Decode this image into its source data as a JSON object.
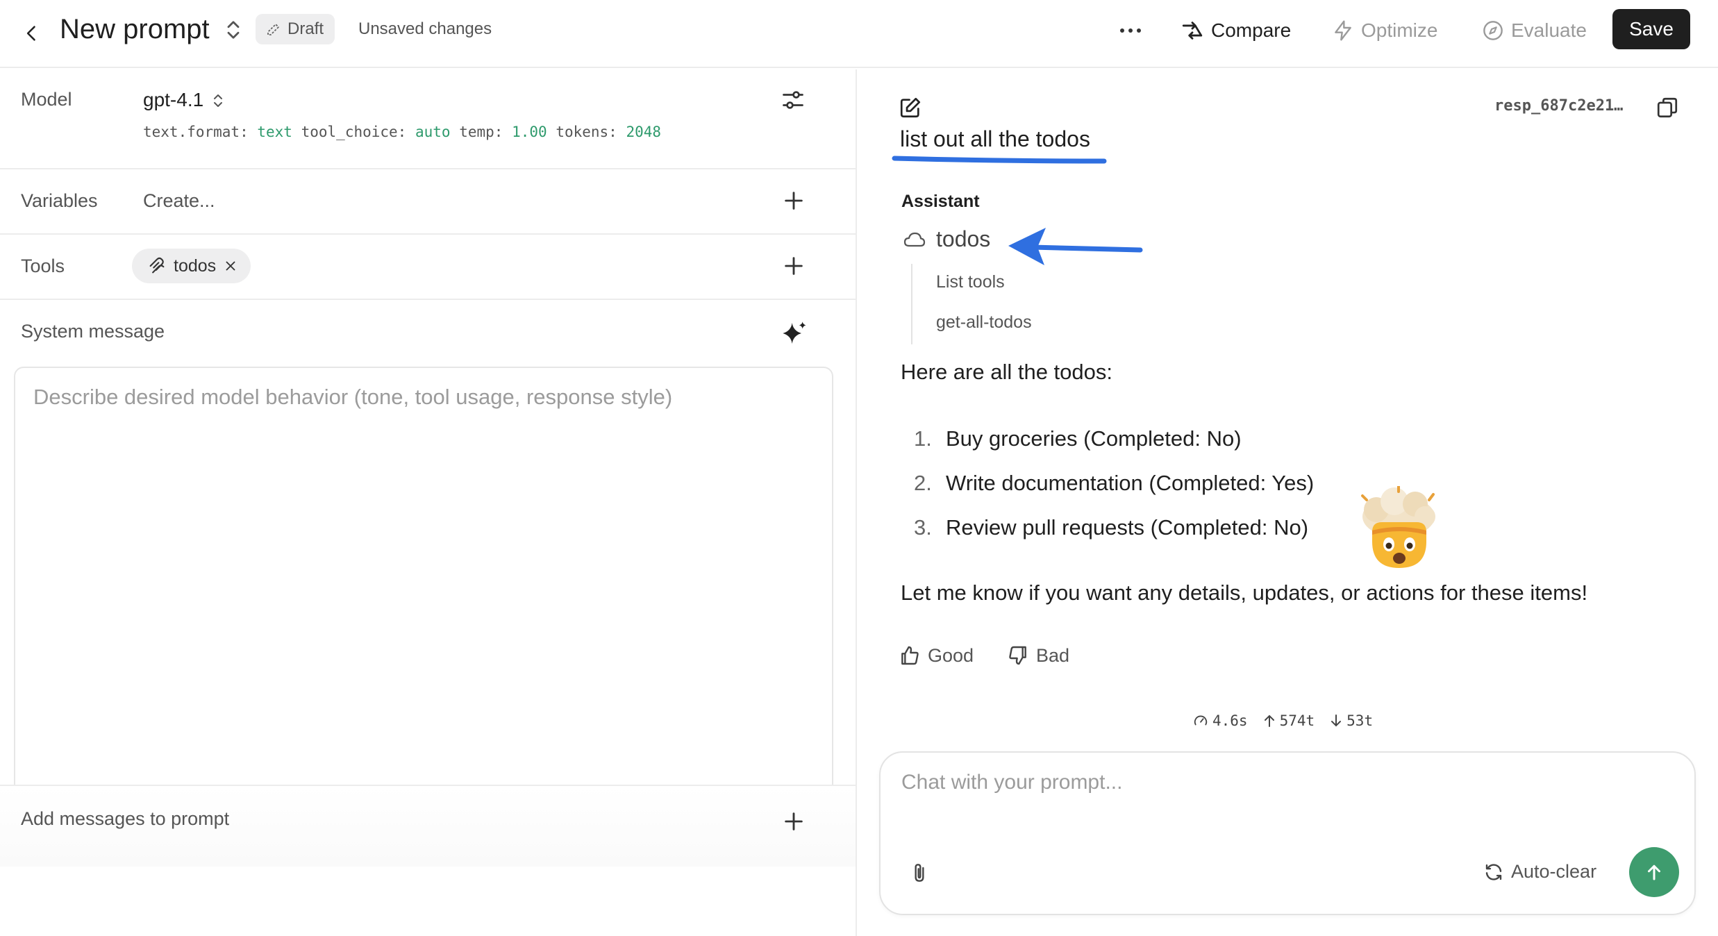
{
  "header": {
    "title": "New prompt",
    "draft_label": "Draft",
    "status": "Unsaved changes",
    "compare_label": "Compare",
    "optimize_label": "Optimize",
    "evaluate_label": "Evaluate",
    "save_label": "Save"
  },
  "config": {
    "model_label": "Model",
    "model_name": "gpt-4.1",
    "meta": {
      "format_key": "text.format:",
      "format_val": "text",
      "tool_choice_key": "tool_choice:",
      "tool_choice_val": "auto",
      "temp_key": "temp:",
      "temp_val": "1.00",
      "tokens_key": "tokens:",
      "tokens_val": "2048"
    },
    "variables_label": "Variables",
    "variables_placeholder": "Create...",
    "tools_label": "Tools",
    "tool_chip": "todos",
    "system_label": "System message",
    "system_placeholder": "Describe desired model behavior (tone, tool usage, response style)",
    "add_messages_label": "Add messages to prompt"
  },
  "conversation": {
    "response_id": "resp_687c2e21…",
    "user_message": "list out all the todos",
    "assistant_label": "Assistant",
    "tool_name": "todos",
    "tool_steps": [
      "List tools",
      "get-all-todos"
    ],
    "response_intro": "Here are all the todos:",
    "todos": [
      {
        "num": "1.",
        "text": "Buy groceries (Completed: No)"
      },
      {
        "num": "2.",
        "text": "Write documentation (Completed: Yes)"
      },
      {
        "num": "3.",
        "text": "Review pull requests (Completed: No)"
      }
    ],
    "response_outro": "Let me know if you want any details, updates, or actions for these items!",
    "good_label": "Good",
    "bad_label": "Bad",
    "stats": {
      "time": "4.6s",
      "input_tokens": "574t",
      "output_tokens": "53t"
    }
  },
  "chat": {
    "placeholder": "Chat with your prompt...",
    "autoclear_label": "Auto-clear"
  },
  "colors": {
    "accent_green": "#3e9c6e",
    "annotation_blue": "#2f6fe0",
    "save_bg": "#1f1f1f"
  },
  "icons": {
    "emoji": "exploding-head-emoji"
  }
}
